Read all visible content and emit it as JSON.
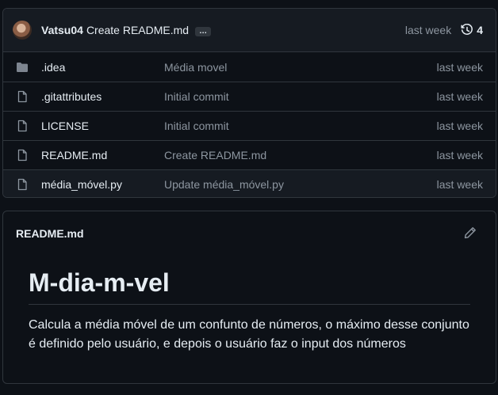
{
  "commit": {
    "author": "Vatsu04",
    "message": "Create README.md",
    "ellipsis": "…",
    "time": "last week",
    "history_count": "4"
  },
  "files": [
    {
      "name": ".idea",
      "type": "folder",
      "commit": "Média movel",
      "time": "last week"
    },
    {
      "name": ".gitattributes",
      "type": "file",
      "commit": "Initial commit",
      "time": "last week"
    },
    {
      "name": "LICENSE",
      "type": "file",
      "commit": "Initial commit",
      "time": "last week"
    },
    {
      "name": "README.md",
      "type": "file",
      "commit": "Create README.md",
      "time": "last week"
    },
    {
      "name": "média_móvel.py",
      "type": "file",
      "commit": "Update média_móvel.py",
      "time": "last week"
    }
  ],
  "readme": {
    "filename": "README.md",
    "heading": "M-dia-m-vel",
    "paragraph": "Calcula a média móvel de um confunto de números, o máximo desse conjunto é definido pelo usuário, e depois o usuário faz o input dos números"
  },
  "icons": {
    "folder": "folder-icon",
    "file": "file-icon",
    "history": "history-icon",
    "edit": "pencil-icon"
  },
  "colors": {
    "background": "#0d1117",
    "header_background": "#161b22",
    "border": "#30363d",
    "text": "#e6edf3",
    "muted": "#8d96a0",
    "folder": "#7d8590"
  }
}
